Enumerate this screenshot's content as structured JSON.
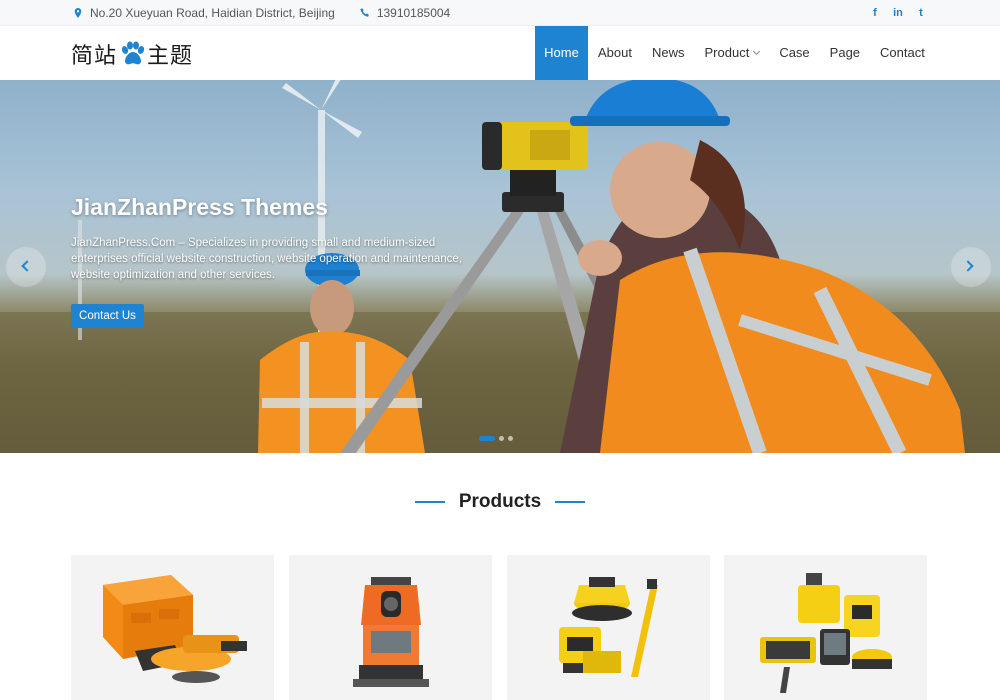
{
  "topbar": {
    "address": "No.20 Xueyuan Road, Haidian District, Beijing",
    "phone": "13910185004",
    "social": [
      {
        "icon": "facebook-icon",
        "glyph": "f"
      },
      {
        "icon": "linkedin-icon",
        "glyph": "in"
      },
      {
        "icon": "twitter-icon",
        "glyph": "t"
      }
    ]
  },
  "header": {
    "logo_left": "简站",
    "logo_right": "主题",
    "logo_icon": "paw-icon",
    "nav": [
      {
        "label": "Home",
        "active": true
      },
      {
        "label": "About"
      },
      {
        "label": "News"
      },
      {
        "label": "Product",
        "has_dropdown": true
      },
      {
        "label": "Case"
      },
      {
        "label": "Page"
      },
      {
        "label": "Contact"
      }
    ]
  },
  "hero": {
    "title": "JianZhanPress Themes",
    "description": "JianZhanPress.Com – Specializes in providing small and medium-sized enterprises official website construction, website operation and maintenance, website optimization and other services.",
    "cta_label": "Contact Us",
    "slide_count": 3,
    "active_slide": 1
  },
  "products": {
    "heading": "Products",
    "items": [
      {
        "image": "orange-level-case-image"
      },
      {
        "image": "orange-theodolite-image"
      },
      {
        "image": "yellow-laser-level-set-image"
      },
      {
        "image": "yellow-total-station-set-image"
      }
    ]
  },
  "colors": {
    "accent": "#1e84d2",
    "topbar_bg": "#f7f8fa",
    "card_bg": "#f3f3f3"
  }
}
